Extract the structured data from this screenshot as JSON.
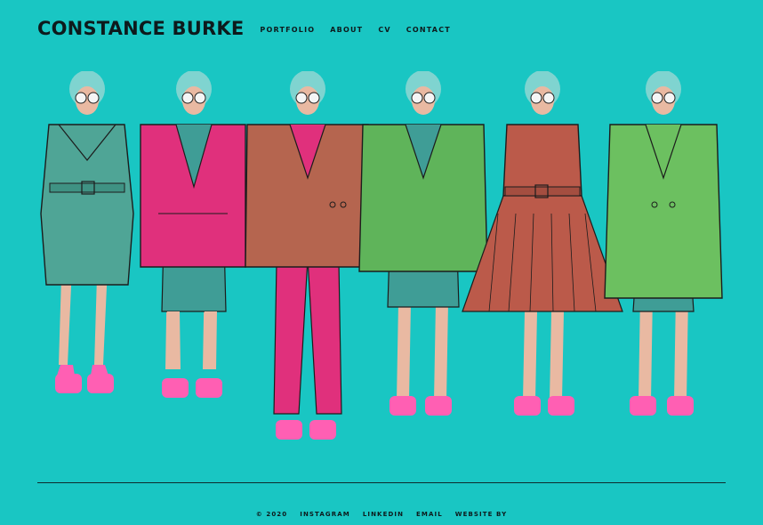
{
  "header": {
    "brand": "CONSTANCE BURKE",
    "nav": [
      "PORTFOLIO",
      "ABOUT",
      "CV",
      "CONTACT"
    ]
  },
  "lineup": {
    "image_name": "fashion-lineup-illustration",
    "figures": [
      {
        "garment": "teal belted coat dress",
        "color": "#4fa596"
      },
      {
        "garment": "pink jacket with leopard romper",
        "color": "#e0307c"
      },
      {
        "garment": "rust jacket with pink trousers",
        "color": "#b5654f"
      },
      {
        "garment": "green puffer jacket with leopard shorts",
        "color": "#5fb45a"
      },
      {
        "garment": "rust belted pleated dress",
        "color": "#bb5a4a"
      },
      {
        "garment": "green double-breasted coat",
        "color": "#6cc060"
      }
    ],
    "skin": "#e9b9a2",
    "hair": "#7fd4d0",
    "sneaker": "#ff5fb3"
  },
  "footer": {
    "copyright": "© 2020",
    "links": [
      "INSTAGRAM",
      "LINKEDIN",
      "EMAIL",
      "WEBSITE BY"
    ]
  },
  "colors": {
    "background": "#19c6c3",
    "text": "#0d1a1c"
  }
}
